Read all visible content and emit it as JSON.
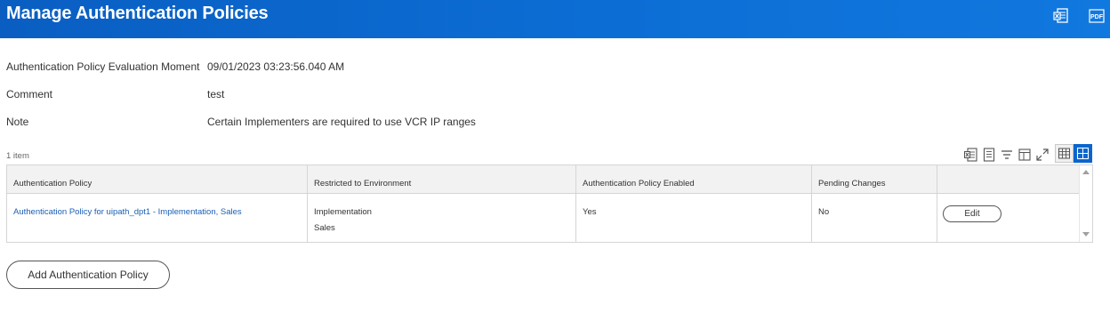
{
  "header": {
    "title": "Manage Authentication Policies",
    "actions": [
      {
        "icon": "excel-export-icon"
      },
      {
        "icon": "pdf-export-icon",
        "label": "PDF"
      }
    ],
    "bg_color": "#0c6fd6"
  },
  "fields": [
    {
      "label": "Authentication Policy Evaluation Moment",
      "value": "09/01/2023 03:23:56.040 AM"
    },
    {
      "label": "Comment",
      "value": "test"
    },
    {
      "label": "Note",
      "value": "Certain Implementers are required to use VCR IP ranges"
    }
  ],
  "grid": {
    "item_count": "1 item",
    "toolbar_icons": [
      "export-excel-icon",
      "export-list-icon",
      "filter-icon",
      "columns-icon",
      "expand-icon",
      "table-view-icon",
      "grid-view-icon"
    ],
    "columns": [
      "Authentication Policy",
      "Restricted to Environment",
      "Authentication Policy Enabled",
      "Pending Changes",
      ""
    ],
    "rows": [
      {
        "policy": "Authentication Policy for uipath_dpt1 - Implementation, Sales",
        "environments": [
          "Implementation",
          "Sales"
        ],
        "enabled": "Yes",
        "pending": "No",
        "action_label": "Edit"
      }
    ]
  },
  "add_button_label": "Add Authentication Policy",
  "colors": {
    "link": "#1a5fb4",
    "accent": "#0a65cc"
  }
}
